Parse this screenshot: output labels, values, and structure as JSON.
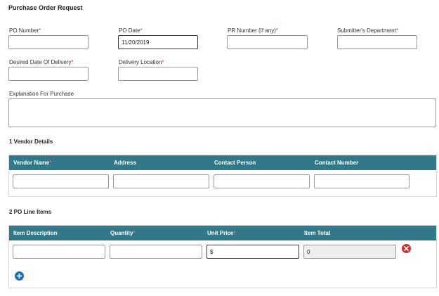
{
  "form": {
    "title": "Purchase Order Request",
    "required_mark": "*",
    "fields": {
      "po_number": {
        "label": "PO Number",
        "value": ""
      },
      "po_date": {
        "label": "PO Date",
        "value": "11/20/2019"
      },
      "pr_number": {
        "label": "PR Number (If any)",
        "value": ""
      },
      "submitter_department": {
        "label": "Submitter's Department",
        "value": ""
      },
      "desired_delivery_date": {
        "label": "Desired Date Of Delivery",
        "value": ""
      },
      "delivery_location": {
        "label": "Delivery Location",
        "value": ""
      },
      "explanation": {
        "label": "Explanation For Purchase",
        "value": ""
      }
    }
  },
  "vendor": {
    "section_title": "1 Vendor Details",
    "columns": {
      "name": "Vendor Name",
      "address": "Address",
      "contact_person": "Contact Person",
      "contact_number": "Contact Number"
    },
    "row": {
      "name": "",
      "address": "",
      "contact_person": "",
      "contact_number": ""
    }
  },
  "line_items": {
    "section_title": "2 PO Line Items",
    "columns": {
      "description": "Item Description",
      "quantity": "Quantity",
      "unit_price": "Unit Price",
      "item_total": "Item Total"
    },
    "row": {
      "description": "",
      "quantity": "",
      "unit_price": "$",
      "item_total": "0"
    }
  },
  "icons": {
    "remove_row": "close-circle-icon",
    "add_row": "plus-circle-icon"
  },
  "colors": {
    "header": "#31798a",
    "required": "#e03a3a",
    "remove": "#d32f2f",
    "add": "#1e6fb8"
  }
}
